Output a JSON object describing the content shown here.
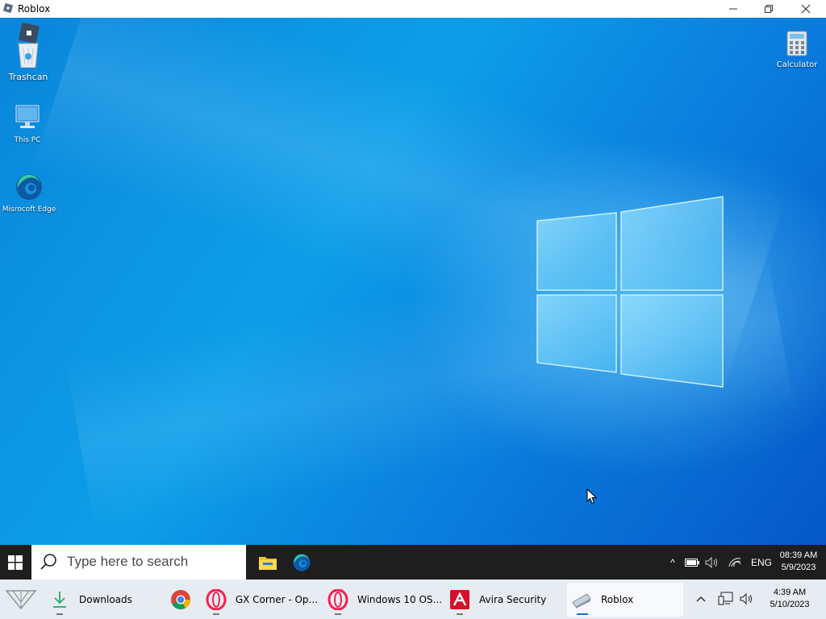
{
  "window": {
    "title": "Roblox",
    "controls": [
      "minimize-icon",
      "maximize-icon",
      "close-icon"
    ]
  },
  "desktop": {
    "icons": [
      {
        "label": "Trashcan",
        "icon": "roblox-recycle-bin-icon"
      },
      {
        "label": "This PC",
        "icon": "computer-icon"
      },
      {
        "label": "Misrocoft Edge",
        "icon": "edge-icon"
      },
      {
        "label": "Calculator",
        "icon": "calculator-icon"
      }
    ],
    "colors": {
      "wallpaper": "#0a86da",
      "logo": "#7fd6ff"
    }
  },
  "remote_taskbar": {
    "search_placeholder": "Type here to search",
    "pinned": [
      "file-explorer-icon",
      "edge-icon"
    ],
    "tray": {
      "chevron": "^",
      "language": "ENG",
      "time": "08:39 AM",
      "date": "5/9/2023"
    }
  },
  "host_taskbar": {
    "items": [
      {
        "label": "Downloads",
        "icon": "download-arrow-icon"
      },
      {
        "label": "",
        "icon": "chrome-icon"
      },
      {
        "label": "GX Corner - Op...",
        "icon": "opera-icon"
      },
      {
        "label": "Windows 10 OS...",
        "icon": "opera-icon"
      },
      {
        "label": "Avira Security",
        "icon": "avira-icon"
      },
      {
        "label": "Roblox",
        "icon": "roblox-icon"
      }
    ],
    "tray": {
      "time": "4:39 AM",
      "date": "5/10/2023"
    }
  }
}
